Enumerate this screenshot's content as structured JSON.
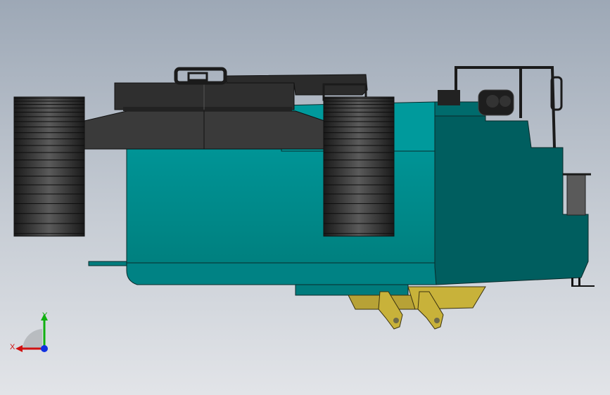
{
  "viewport": {
    "background_top": "#9da8b6",
    "background_bottom": "#e2e4e8"
  },
  "model": {
    "body_color": "#008a8c",
    "body_dark_color": "#005f60",
    "track_color": "#2a2a2a",
    "turntable_color": "#2f2f2f",
    "bracket_color": "#c8b23a"
  },
  "triad": {
    "x_label": "X",
    "y_label": "Y",
    "x_color": "#d01010",
    "y_color": "#10b010",
    "z_color": "#1030e0"
  }
}
